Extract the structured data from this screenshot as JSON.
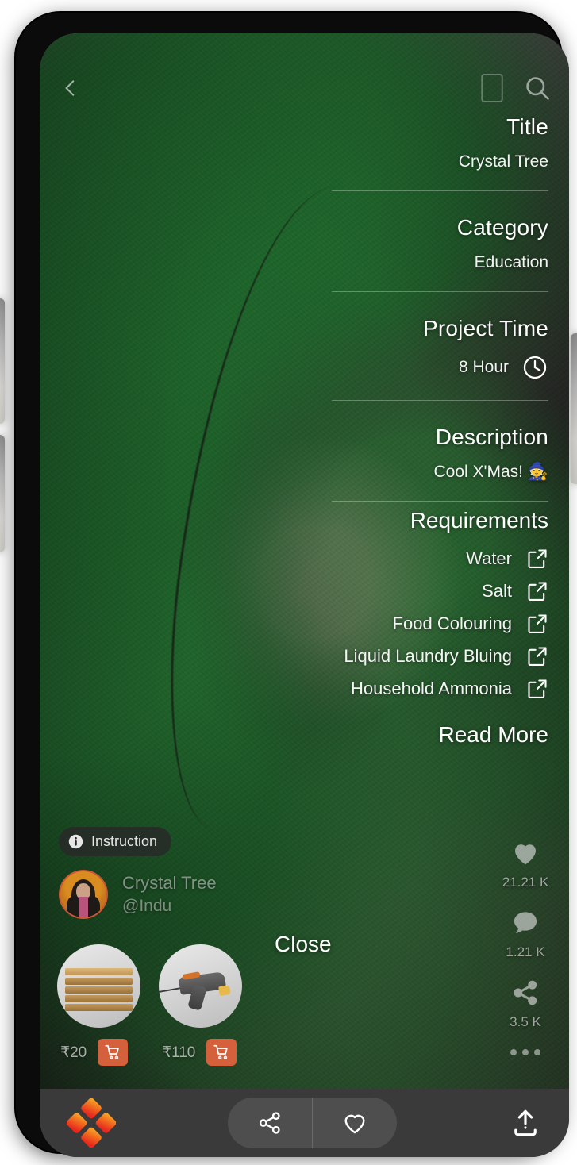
{
  "topbar": {
    "back_icon": "chevron-left-icon",
    "book_icon": "book-icon",
    "search_icon": "search-icon"
  },
  "detail": {
    "fields": [
      {
        "label": "Title",
        "value": "Crystal Tree"
      },
      {
        "label": "Category",
        "value": "Education"
      },
      {
        "label": "Project Time",
        "value": "8 Hour",
        "icon": "clock-icon"
      },
      {
        "label": "Description",
        "value": "Cool X'Mas! 🧙"
      }
    ],
    "requirements_title": "Requirements",
    "requirements": [
      {
        "name": "Water",
        "icon": "external-link-icon"
      },
      {
        "name": "Salt",
        "icon": "external-link-icon"
      },
      {
        "name": "Food Colouring",
        "icon": "external-link-icon"
      },
      {
        "name": "Liquid Laundry Bluing",
        "icon": "external-link-icon"
      },
      {
        "name": "Household Ammonia",
        "icon": "external-link-icon"
      }
    ],
    "read_more": "Read More",
    "close": "Close"
  },
  "rail": {
    "like": {
      "icon": "heart-filled-icon",
      "count": "21.21 K"
    },
    "comment": {
      "icon": "comment-icon",
      "count": "1.21 K"
    },
    "share": {
      "icon": "share-icon",
      "count": "3.5 K"
    },
    "more": {
      "icon": "ellipsis-icon"
    }
  },
  "instruction": {
    "icon": "info-icon",
    "label": "Instruction"
  },
  "author": {
    "avatar": "user-avatar",
    "title": "Crystal Tree",
    "handle": "@Indu"
  },
  "products": [
    {
      "thumb": "cardboard-sheets-thumbnail",
      "price": "₹20",
      "cart_icon": "cart-icon"
    },
    {
      "thumb": "glue-gun-thumbnail",
      "price": "₹110",
      "cart_icon": "cart-icon"
    }
  ],
  "bottombar": {
    "logo": "app-logo-diamond",
    "share_icon": "share-icon",
    "heart_icon": "heart-outline-icon",
    "upload_icon": "upload-icon"
  },
  "colors": {
    "accent_orange": "#d4603c",
    "logo_yellow": "#f9b22a",
    "logo_orange": "#f2701f",
    "logo_red": "#e8281e",
    "bottom_bar": "#3a3a3a"
  }
}
